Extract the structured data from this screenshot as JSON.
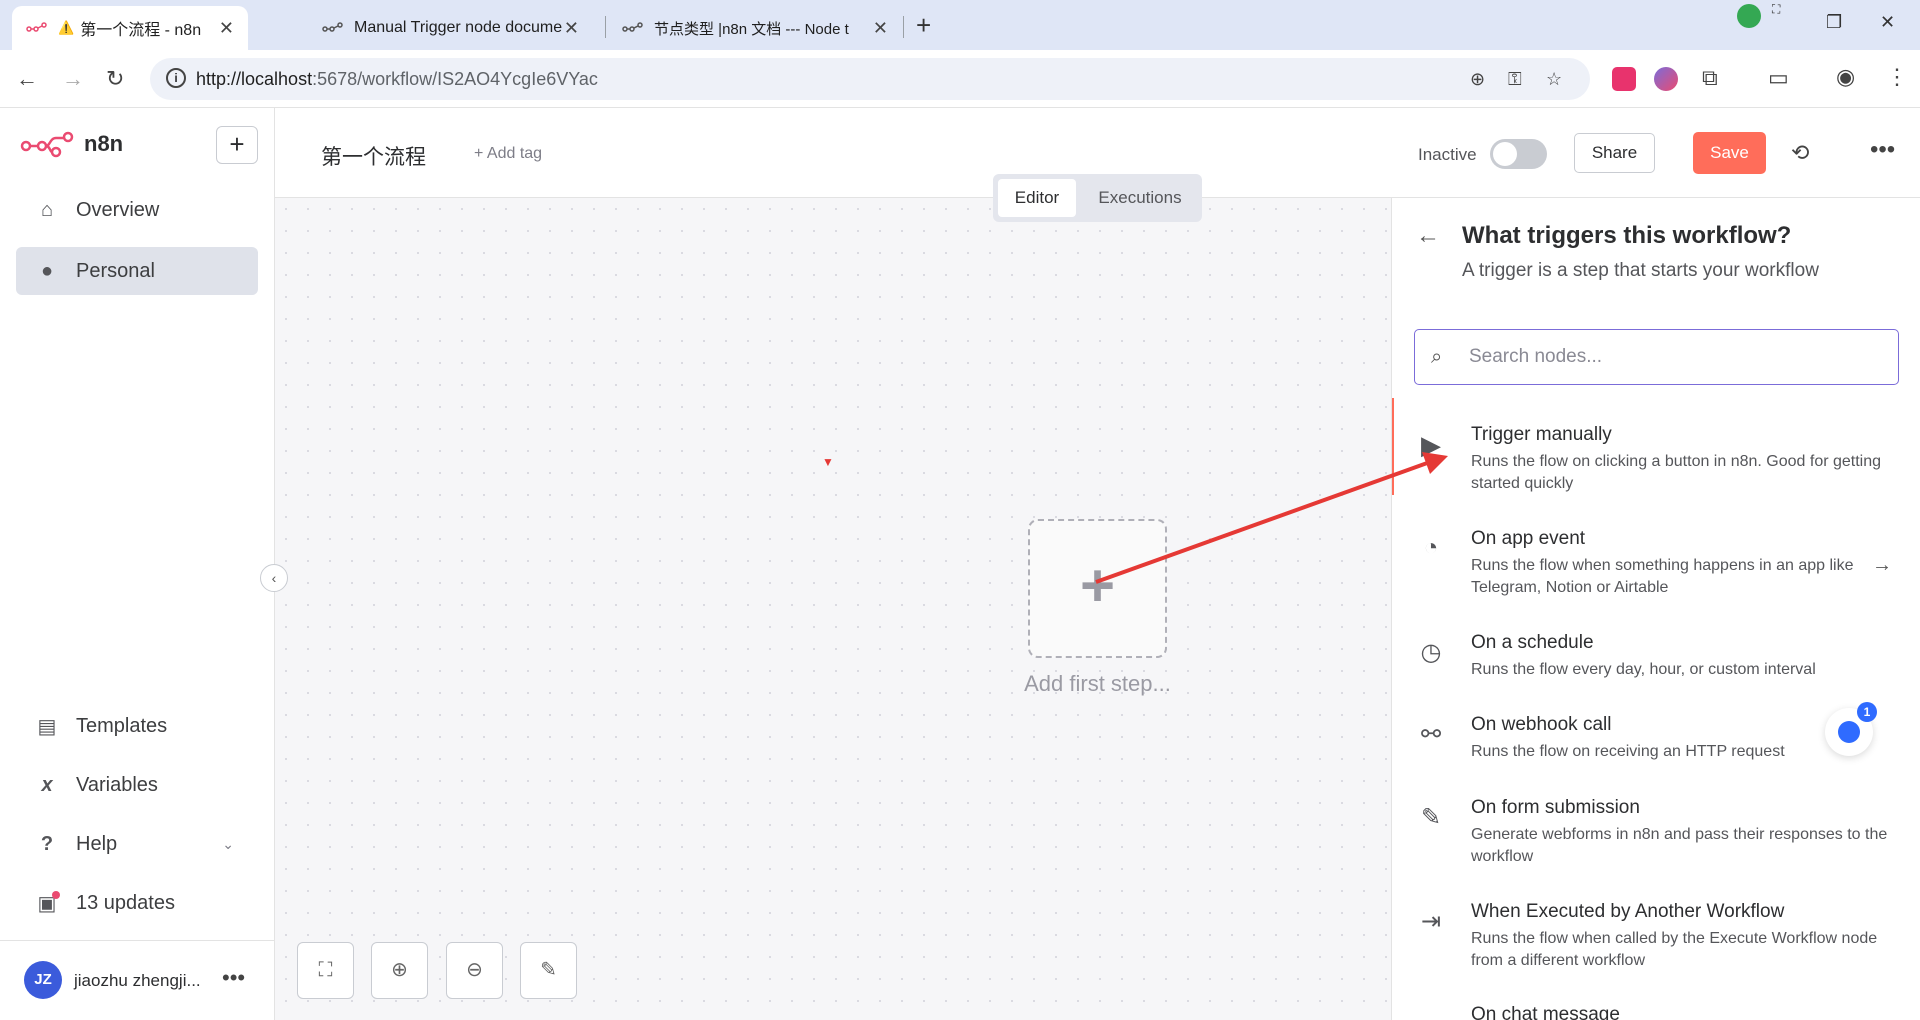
{
  "browser": {
    "tabs": [
      {
        "title": "第一个流程 - n8n",
        "warning": "⚠️",
        "active": true
      },
      {
        "title": "Manual Trigger node docume",
        "active": false
      },
      {
        "title": "节点类型 |n8n 文档 --- Node t",
        "active": false
      }
    ],
    "new_tab": "+",
    "url_host": "http://localhost",
    "url_rest": ":5678/workflow/IS2AO4YcgIe6VYac"
  },
  "sidebar": {
    "brand": "n8n",
    "new_button": "+",
    "items": [
      {
        "label": "Overview",
        "icon": "home-icon"
      },
      {
        "label": "Personal",
        "icon": "user-icon",
        "active": true
      }
    ],
    "bottom_items": [
      {
        "label": "Templates",
        "icon": "box-icon"
      },
      {
        "label": "Variables",
        "icon": "variable-icon"
      },
      {
        "label": "Help",
        "icon": "question-icon"
      },
      {
        "label": "13 updates",
        "icon": "gift-icon"
      }
    ],
    "user": {
      "initials": "JZ",
      "name": "jiaozhu zhengji..."
    }
  },
  "header": {
    "workflow_name": "第一个流程",
    "add_tag": "+ Add tag",
    "status_label": "Inactive",
    "share_label": "Share",
    "save_label": "Save"
  },
  "canvas": {
    "modes": [
      "Editor",
      "Executions"
    ],
    "add_first_step": "Add first step..."
  },
  "panel": {
    "title": "What triggers this workflow?",
    "subtitle": "A trigger is a step that starts your workflow",
    "search_placeholder": "Search nodes...",
    "nodes": [
      {
        "title": "Trigger manually",
        "desc": "Runs the flow on clicking a button in n8n. Good for getting started quickly",
        "icon": "cursor-icon"
      },
      {
        "title": "On app event",
        "desc": "Runs the flow when something happens in an app like Telegram, Notion or Airtable",
        "icon": "satellite-icon"
      },
      {
        "title": "On a schedule",
        "desc": "Runs the flow every day, hour, or custom interval",
        "icon": "clock-icon"
      },
      {
        "title": "On webhook call",
        "desc": "Runs the flow on receiving an HTTP request",
        "icon": "webhook-icon"
      },
      {
        "title": "On form submission",
        "desc": "Generate webforms in n8n and pass their responses to the workflow",
        "icon": "form-icon"
      },
      {
        "title": "When Executed by Another Workflow",
        "desc": "Runs the flow when called by the Execute Workflow node from a different workflow",
        "icon": "sign-in-icon"
      },
      {
        "title": "On chat message",
        "desc": "",
        "icon": "chat-icon"
      }
    ]
  },
  "chat_widget": {
    "count": "1"
  },
  "colors": {
    "accent": "#ff6d5a",
    "annotation": "#e53935",
    "focus": "#7b6cd9"
  }
}
